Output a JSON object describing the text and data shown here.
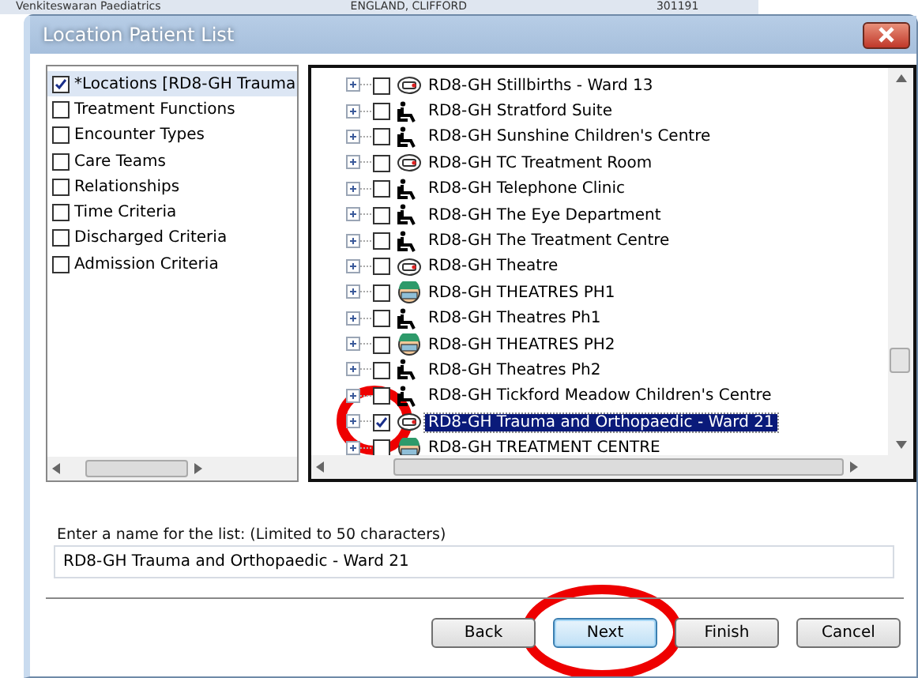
{
  "background_row": [
    "Venkiteswaran Paediatrics",
    "ENGLAND, CLIFFORD",
    "301191"
  ],
  "window": {
    "title": "Location Patient List"
  },
  "criteria": [
    {
      "label": "*Locations [RD8-GH Trauma",
      "checked": true,
      "selected": true
    },
    {
      "label": "Treatment Functions",
      "checked": false,
      "selected": false
    },
    {
      "label": "Encounter Types",
      "checked": false,
      "selected": false
    },
    {
      "label": "Care Teams",
      "checked": false,
      "selected": false
    },
    {
      "label": "Relationships",
      "checked": false,
      "selected": false
    },
    {
      "label": "Time Criteria",
      "checked": false,
      "selected": false
    },
    {
      "label": "Discharged Criteria",
      "checked": false,
      "selected": false
    },
    {
      "label": "Admission Criteria",
      "checked": false,
      "selected": false
    }
  ],
  "locations": [
    {
      "label": "RD8-GH Stillbirths - Ward 13",
      "kind": "phone",
      "checked": false,
      "selected": false
    },
    {
      "label": "RD8-GH Stratford Suite",
      "kind": "wheelchair",
      "checked": false,
      "selected": false
    },
    {
      "label": "RD8-GH Sunshine Children's Centre",
      "kind": "wheelchair",
      "checked": false,
      "selected": false
    },
    {
      "label": "RD8-GH TC Treatment Room",
      "kind": "phone",
      "checked": false,
      "selected": false
    },
    {
      "label": "RD8-GH Telephone Clinic",
      "kind": "wheelchair",
      "checked": false,
      "selected": false
    },
    {
      "label": "RD8-GH The Eye Department",
      "kind": "wheelchair",
      "checked": false,
      "selected": false
    },
    {
      "label": "RD8-GH The Treatment Centre",
      "kind": "wheelchair",
      "checked": false,
      "selected": false
    },
    {
      "label": "RD8-GH Theatre",
      "kind": "phone",
      "checked": false,
      "selected": false
    },
    {
      "label": "RD8-GH THEATRES PH1",
      "kind": "surgeon",
      "checked": false,
      "selected": false
    },
    {
      "label": "RD8-GH Theatres Ph1",
      "kind": "wheelchair",
      "checked": false,
      "selected": false
    },
    {
      "label": "RD8-GH THEATRES PH2",
      "kind": "surgeon",
      "checked": false,
      "selected": false
    },
    {
      "label": "RD8-GH Theatres Ph2",
      "kind": "wheelchair",
      "checked": false,
      "selected": false
    },
    {
      "label": "RD8-GH Tickford Meadow Children's Centre",
      "kind": "wheelchair",
      "checked": false,
      "selected": false
    },
    {
      "label": "RD8-GH Trauma and Orthopaedic - Ward 21",
      "kind": "phone",
      "checked": true,
      "selected": true
    },
    {
      "label": "RD8-GH TREATMENT CENTRE",
      "kind": "surgeon",
      "checked": false,
      "selected": false
    }
  ],
  "name_field": {
    "label": "Enter a name for the list: (Limited to 50 characters)",
    "value": "RD8-GH Trauma and Orthopaedic - Ward 21"
  },
  "buttons": [
    {
      "label": "Back",
      "selected": false
    },
    {
      "label": "Next",
      "selected": true
    },
    {
      "label": "Finish",
      "selected": false
    },
    {
      "label": "Cancel",
      "selected": false
    }
  ]
}
